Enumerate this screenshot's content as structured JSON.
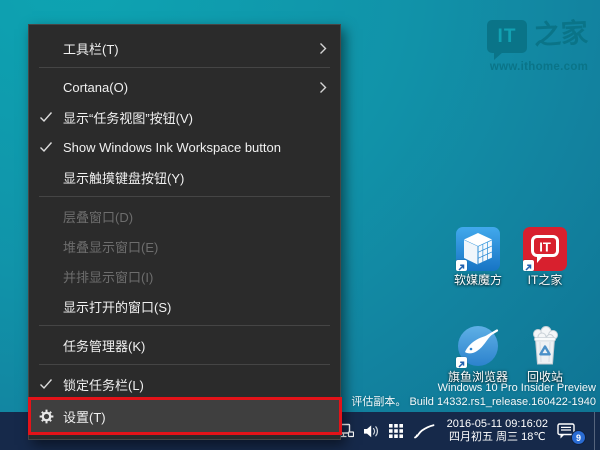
{
  "colors": {
    "wallpaper_teal": "#1193a9",
    "menu_bg": "#2b2b2b",
    "menu_hover": "#3f3f3f",
    "menu_disabled_text": "#6d6d6d",
    "highlight_red": "#e31319",
    "taskbar_navy": "#16294a",
    "badge_blue": "#2a6bd2",
    "ithome_red": "#d8202e",
    "ruanmei_blue": "#1d82d2",
    "logo_teal_dark": "#0a7386"
  },
  "desktop": {
    "logo": {
      "it": "IT",
      "home": "之家",
      "url": "www.ithome.com"
    },
    "icons": [
      {
        "label": "软媒魔方"
      },
      {
        "label": "IT之家"
      },
      {
        "label": "旗鱼浏览器"
      },
      {
        "label": "回收站"
      }
    ],
    "watermark": {
      "line1": "Windows 10 Pro Insider Preview",
      "line2": "评估副本。 Build 14332.rs1_release.160422-1940"
    }
  },
  "context_menu": {
    "items": [
      {
        "label": "工具栏(T)",
        "submenu": true
      },
      {
        "label": "Cortana(O)",
        "submenu": true
      },
      {
        "label": "显示“任务视图”按钮(V)",
        "checked": true
      },
      {
        "label": "Show Windows Ink Workspace button",
        "checked": true
      },
      {
        "label": "显示触摸键盘按钮(Y)"
      },
      {
        "label": "层叠窗口(D)",
        "disabled": true
      },
      {
        "label": "堆叠显示窗口(E)",
        "disabled": true
      },
      {
        "label": "并排显示窗口(I)",
        "disabled": true
      },
      {
        "label": "显示打开的窗口(S)"
      },
      {
        "label": "任务管理器(K)"
      },
      {
        "label": "锁定任务栏(L)",
        "checked": true
      },
      {
        "label": "设置(T)",
        "icon": "gear",
        "highlighted": true
      }
    ]
  },
  "taskbar": {
    "tray_icons": [
      "network",
      "volume",
      "grid",
      "pen"
    ],
    "clock": {
      "line1": "2016-05-11  09:16:02",
      "line2": "四月初五 周三 18℃"
    },
    "action_center_badge": "9"
  }
}
